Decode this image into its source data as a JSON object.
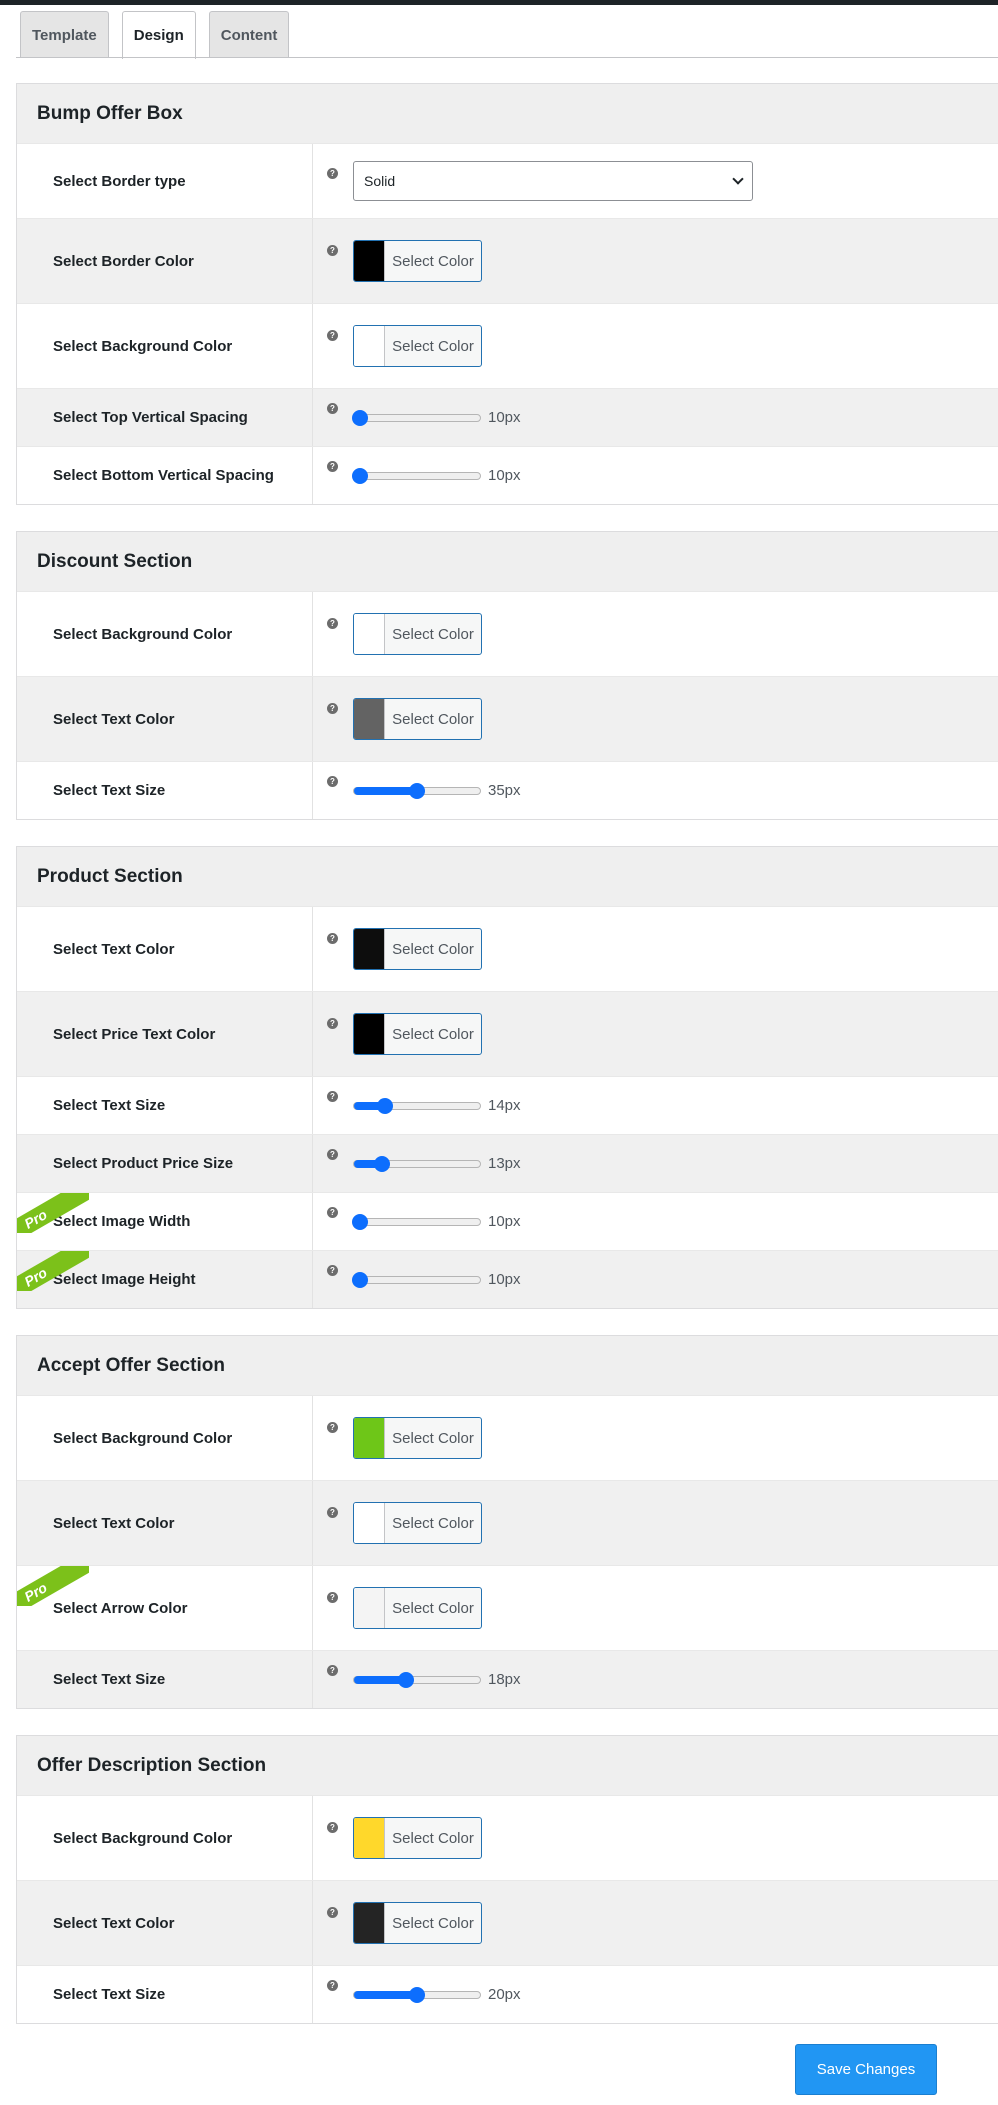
{
  "tabs": [
    {
      "label": "Template"
    },
    {
      "label": "Design"
    },
    {
      "label": "Content"
    }
  ],
  "help_glyph": "?",
  "sections": {
    "bump": {
      "title": "Bump Offer Box",
      "border_type": {
        "label": "Select Border type",
        "value": "Solid"
      },
      "border_color": {
        "label": "Select Border Color",
        "button": "Select Color",
        "color": "#000000"
      },
      "bg_color": {
        "label": "Select Background Color",
        "button": "Select Color",
        "color": "#ffffff"
      },
      "top_spacing": {
        "label": "Select Top Vertical Spacing",
        "value": "10px",
        "fraction": 0.0
      },
      "bottom_spacing": {
        "label": "Select Bottom Vertical Spacing",
        "value": "10px",
        "fraction": 0.0
      }
    },
    "discount": {
      "title": "Discount Section",
      "bg_color": {
        "label": "Select Background Color",
        "button": "Select Color",
        "color": "#ffffff"
      },
      "text_color": {
        "label": "Select Text Color",
        "button": "Select Color",
        "color": "#636363"
      },
      "text_size": {
        "label": "Select Text Size",
        "value": "35px",
        "fraction": 0.5
      }
    },
    "product": {
      "title": "Product Section",
      "text_color": {
        "label": "Select Text Color",
        "button": "Select Color",
        "color": "#0d0d0d"
      },
      "price_color": {
        "label": "Select Price Text Color",
        "button": "Select Color",
        "color": "#000000"
      },
      "text_size": {
        "label": "Select Text Size",
        "value": "14px",
        "fraction": 0.22
      },
      "price_size": {
        "label": "Select Product Price Size",
        "value": "13px",
        "fraction": 0.19
      },
      "image_width": {
        "label": "Select Image Width",
        "value": "10px",
        "fraction": 0.0,
        "badge": "Pro"
      },
      "image_height": {
        "label": "Select Image Height",
        "value": "10px",
        "fraction": 0.0,
        "badge": "Pro"
      }
    },
    "accept": {
      "title": "Accept Offer Section",
      "bg_color": {
        "label": "Select Background Color",
        "button": "Select Color",
        "color": "#6ec618"
      },
      "text_color": {
        "label": "Select Text Color",
        "button": "Select Color",
        "color": "#ffffff"
      },
      "arrow_color": {
        "label": "Select Arrow Color",
        "button": "Select Color",
        "color": "#f4f4f4",
        "badge": "Pro"
      },
      "text_size": {
        "label": "Select Text Size",
        "value": "18px",
        "fraction": 0.4
      }
    },
    "description": {
      "title": "Offer Description Section",
      "bg_color": {
        "label": "Select Background Color",
        "button": "Select Color",
        "color": "#ffd82b"
      },
      "text_color": {
        "label": "Select Text Color",
        "button": "Select Color",
        "color": "#242424"
      },
      "text_size": {
        "label": "Select Text Size",
        "value": "20px",
        "fraction": 0.5
      }
    }
  },
  "save_label": "Save Changes",
  "accent_color": "#0d6efd"
}
